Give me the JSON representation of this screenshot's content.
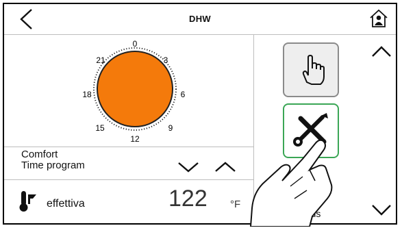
{
  "header": {
    "title": "DHW"
  },
  "icons": {
    "back": "chevron-left-icon",
    "home": "home-person-icon",
    "manual": "hand-pointer-icon",
    "tools": "wrench-screwdriver-icon",
    "thermometer": "thermometer-icon"
  },
  "clock": {
    "hour_labels": [
      "0",
      "3",
      "6",
      "9",
      "12",
      "15",
      "18",
      "21"
    ],
    "fill_color": "#f47a0b"
  },
  "mode": {
    "name": "Comfort",
    "program": "Time program"
  },
  "temperature": {
    "label": "effettiva",
    "value": "122",
    "unit": "°F"
  },
  "side": {
    "status_label": "status"
  },
  "colors": {
    "accent_green": "#3aa655",
    "clock_orange": "#f47a0b"
  }
}
